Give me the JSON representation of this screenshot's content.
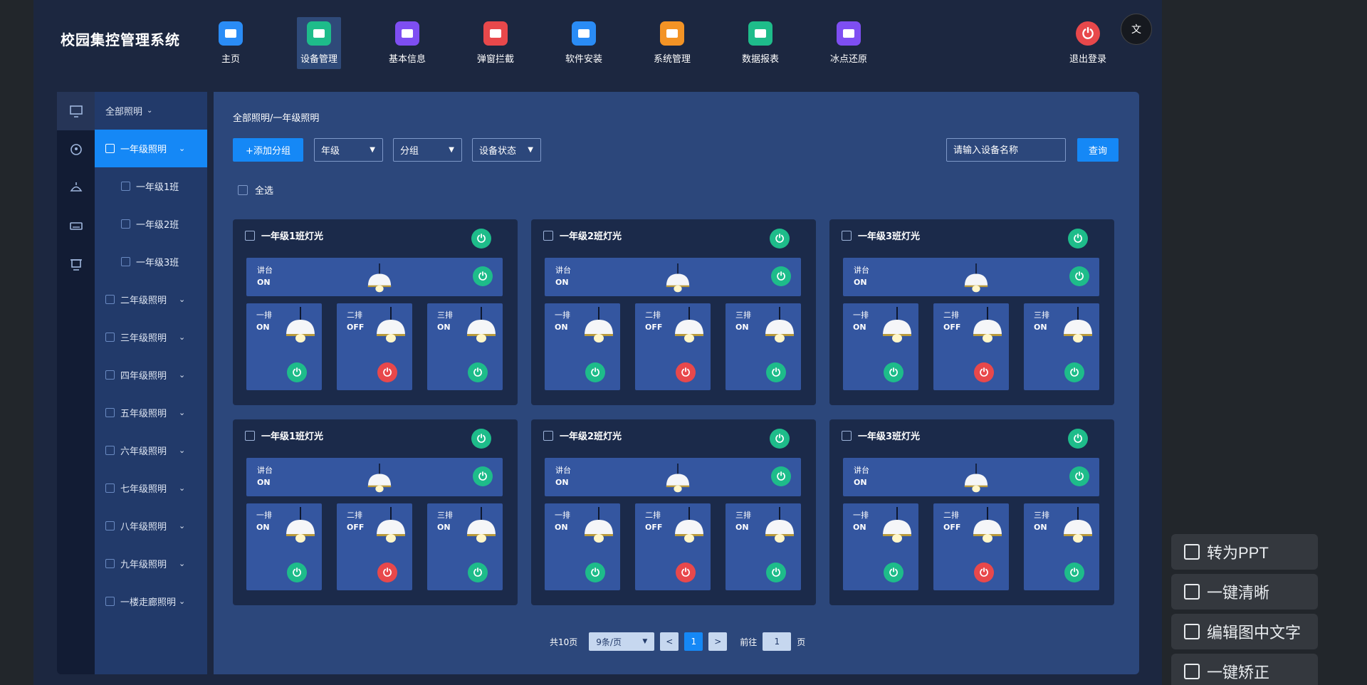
{
  "app": {
    "title": "校园集控管理系统"
  },
  "nav": [
    {
      "label": "主页",
      "color": "#2a8cf6",
      "icon": "home-icon"
    },
    {
      "label": "设备管理",
      "color": "#1ebc8a",
      "icon": "monitor-icon",
      "active": true
    },
    {
      "label": "基本信息",
      "color": "#7e4ef2",
      "icon": "info-card-icon"
    },
    {
      "label": "弹窗拦截",
      "color": "#e8484b",
      "icon": "block-icon"
    },
    {
      "label": "软件安装",
      "color": "#2a8cf6",
      "icon": "download-icon"
    },
    {
      "label": "系统管理",
      "color": "#f39325",
      "icon": "cube-icon"
    },
    {
      "label": "数据报表",
      "color": "#1ebc8a",
      "icon": "chart-icon"
    },
    {
      "label": "冰点还原",
      "color": "#7e4ef2",
      "icon": "restore-icon"
    }
  ],
  "logout": {
    "label": "退出登录",
    "icon": "power-icon"
  },
  "translate": {
    "label": "文"
  },
  "tree": {
    "top": "全部照明",
    "items": [
      {
        "label": "一年级照明",
        "active": true,
        "expanded": true
      },
      {
        "label": "一年级1班",
        "sub": true
      },
      {
        "label": "一年级2班",
        "sub": true
      },
      {
        "label": "一年级3班",
        "sub": true
      },
      {
        "label": "二年级照明"
      },
      {
        "label": "三年级照明"
      },
      {
        "label": "四年级照明"
      },
      {
        "label": "五年级照明"
      },
      {
        "label": "六年级照明"
      },
      {
        "label": "七年级照明"
      },
      {
        "label": "八年级照明"
      },
      {
        "label": "九年级照明"
      },
      {
        "label": "一楼走廊照明"
      }
    ]
  },
  "breadcrumb": "全部照明/一年级照明",
  "toolbar": {
    "add": "+添加分组",
    "grade": "年级",
    "group": "分组",
    "status": "设备状态",
    "search_placeholder": "请输入设备名称",
    "query": "查询",
    "select_all": "全选"
  },
  "cards": [
    {
      "title": "一年级1班灯光",
      "podium": {
        "name": "讲台",
        "state": "ON"
      },
      "rows": [
        {
          "name": "一排",
          "state": "ON"
        },
        {
          "name": "二排",
          "state": "OFF"
        },
        {
          "name": "三排",
          "state": "ON"
        }
      ]
    },
    {
      "title": "一年级2班灯光",
      "podium": {
        "name": "讲台",
        "state": "ON"
      },
      "rows": [
        {
          "name": "一排",
          "state": "ON"
        },
        {
          "name": "二排",
          "state": "OFF"
        },
        {
          "name": "三排",
          "state": "ON"
        }
      ]
    },
    {
      "title": "一年级3班灯光",
      "podium": {
        "name": "讲台",
        "state": "ON"
      },
      "rows": [
        {
          "name": "一排",
          "state": "ON"
        },
        {
          "name": "二排",
          "state": "OFF"
        },
        {
          "name": "三排",
          "state": "ON"
        }
      ]
    },
    {
      "title": "一年级1班灯光",
      "podium": {
        "name": "讲台",
        "state": "ON"
      },
      "rows": [
        {
          "name": "一排",
          "state": "ON"
        },
        {
          "name": "二排",
          "state": "OFF"
        },
        {
          "name": "三排",
          "state": "ON"
        }
      ]
    },
    {
      "title": "一年级2班灯光",
      "podium": {
        "name": "讲台",
        "state": "ON"
      },
      "rows": [
        {
          "name": "一排",
          "state": "ON"
        },
        {
          "name": "二排",
          "state": "OFF"
        },
        {
          "name": "三排",
          "state": "ON"
        }
      ]
    },
    {
      "title": "一年级3班灯光",
      "podium": {
        "name": "讲台",
        "state": "ON"
      },
      "rows": [
        {
          "name": "一排",
          "state": "ON"
        },
        {
          "name": "二排",
          "state": "OFF"
        },
        {
          "name": "三排",
          "state": "ON"
        }
      ]
    }
  ],
  "pager": {
    "total": "共10页",
    "per_page": "9条/页",
    "prev": "<",
    "current": "1",
    "next": ">",
    "goto": "前往",
    "goto_value": "1",
    "page_unit": "页"
  },
  "tools": [
    {
      "label": "转为PPT"
    },
    {
      "label": "一键清晰"
    },
    {
      "label": "编辑图中文字"
    },
    {
      "label": "一键矫正"
    }
  ]
}
